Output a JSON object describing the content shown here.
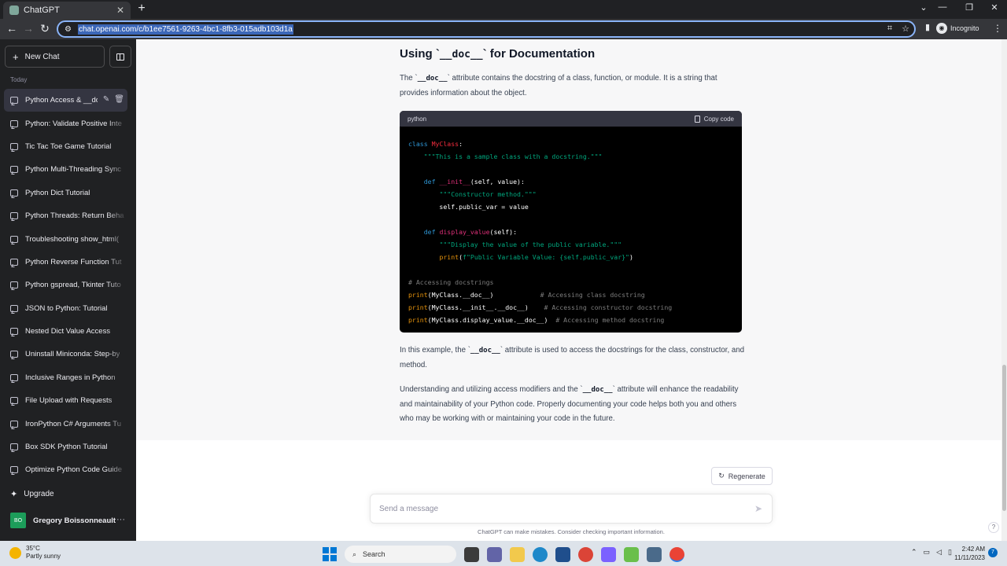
{
  "browser": {
    "tab_title": "ChatGPT",
    "url": "chat.openai.com/c/b1ee7561-9263-4bc1-8fb3-015adb103d1a",
    "incognito_label": "Incognito"
  },
  "sidebar": {
    "new_chat_label": "New Chat",
    "section_label": "Today",
    "items": [
      {
        "label": "Python Access & __do"
      },
      {
        "label": "Python: Validate Positive Inte"
      },
      {
        "label": "Tic Tac Toe Game Tutorial"
      },
      {
        "label": "Python Multi-Threading Sync"
      },
      {
        "label": "Python Dict Tutorial"
      },
      {
        "label": "Python Threads: Return Beha"
      },
      {
        "label": "Troubleshooting show_html("
      },
      {
        "label": "Python Reverse Function Tut"
      },
      {
        "label": "Python gspread, Tkinter Tuto"
      },
      {
        "label": "JSON to Python: Tutorial"
      },
      {
        "label": "Nested Dict Value Access"
      },
      {
        "label": "Uninstall Miniconda: Step-by"
      },
      {
        "label": "Inclusive Ranges in Python"
      },
      {
        "label": "File Upload with Requests"
      },
      {
        "label": "IronPython C# Arguments Tu"
      },
      {
        "label": "Box SDK Python Tutorial"
      },
      {
        "label": "Optimize Python Code Guide"
      }
    ],
    "upgrade_label": "Upgrade",
    "user_initials": "BO",
    "user_name": "Gregory Boissonneault"
  },
  "message": {
    "heading_pre": "Using `",
    "heading_code": "__doc__",
    "heading_post": "` for Documentation",
    "p1_pre": "The `",
    "p1_code": "__doc__",
    "p1_post": "` attribute contains the docstring of a class, function, or module. It is a string that provides information about the object.",
    "code_lang": "python",
    "copy_label": "Copy code",
    "p2_pre": "In this example, the `",
    "p2_code": "__doc__",
    "p2_post": "` attribute is used to access the docstrings for the class, constructor, and method.",
    "p3_pre": "Understanding and utilizing access modifiers and the `",
    "p3_code": "__doc__",
    "p3_post": "` attribute will enhance the readability and maintainability of your Python code. Properly documenting your code helps both you and others who may be working with or maintaining your code in the future."
  },
  "code_lines": [
    [
      {
        "t": "class ",
        "c": "kw"
      },
      {
        "t": "MyClass",
        "c": "cls"
      },
      {
        "t": ":",
        "c": ""
      }
    ],
    [
      {
        "t": "    ",
        "c": ""
      },
      {
        "t": "\"\"\"This is a sample class with a docstring.\"\"\"",
        "c": "str"
      }
    ],
    [
      {
        "t": "",
        "c": ""
      }
    ],
    [
      {
        "t": "    ",
        "c": ""
      },
      {
        "t": "def ",
        "c": "kw"
      },
      {
        "t": "__init__",
        "c": "fn"
      },
      {
        "t": "(self, value):",
        "c": ""
      }
    ],
    [
      {
        "t": "        ",
        "c": ""
      },
      {
        "t": "\"\"\"Constructor method.\"\"\"",
        "c": "str"
      }
    ],
    [
      {
        "t": "        self.public_var = value",
        "c": ""
      }
    ],
    [
      {
        "t": "",
        "c": ""
      }
    ],
    [
      {
        "t": "    ",
        "c": ""
      },
      {
        "t": "def ",
        "c": "kw"
      },
      {
        "t": "display_value",
        "c": "fn"
      },
      {
        "t": "(self):",
        "c": ""
      }
    ],
    [
      {
        "t": "        ",
        "c": ""
      },
      {
        "t": "\"\"\"Display the value of the public variable.\"\"\"",
        "c": "str"
      }
    ],
    [
      {
        "t": "        ",
        "c": ""
      },
      {
        "t": "print",
        "c": "bi"
      },
      {
        "t": "(",
        "c": ""
      },
      {
        "t": "f\"Public Variable Value: {self.public_var}\"",
        "c": "str"
      },
      {
        "t": ")",
        "c": ""
      }
    ],
    [
      {
        "t": "",
        "c": ""
      }
    ],
    [
      {
        "t": "# Accessing docstrings",
        "c": "cmt"
      }
    ],
    [
      {
        "t": "print",
        "c": "bi"
      },
      {
        "t": "(MyClass.__doc__)            ",
        "c": ""
      },
      {
        "t": "# Accessing class docstring",
        "c": "cmt"
      }
    ],
    [
      {
        "t": "print",
        "c": "bi"
      },
      {
        "t": "(MyClass.__init__.__doc__)    ",
        "c": ""
      },
      {
        "t": "# Accessing constructor docstring",
        "c": "cmt"
      }
    ],
    [
      {
        "t": "print",
        "c": "bi"
      },
      {
        "t": "(MyClass.display_value.__doc__)  ",
        "c": ""
      },
      {
        "t": "# Accessing method docstring",
        "c": "cmt"
      }
    ]
  ],
  "composer": {
    "regenerate_label": "Regenerate",
    "placeholder": "Send a message",
    "disclaimer": "ChatGPT can make mistakes. Consider checking important information.",
    "help": "?"
  },
  "taskbar": {
    "temp": "35°C",
    "condition": "Partly sunny",
    "search_label": "Search",
    "time": "2:42 AM",
    "date": "11/11/2023"
  },
  "colors": {
    "sidebar_bg": "#202123",
    "accent": "#8ab4f8",
    "code_bg": "#000000",
    "avatar_bg": "#1c9d5a"
  },
  "icons": [
    "plus-icon",
    "sidebar-toggle-icon",
    "chat-bubble-icon",
    "edit-icon",
    "trash-icon",
    "sparkle-icon",
    "ellipsis-icon",
    "clipboard-icon",
    "refresh-icon",
    "send-icon"
  ]
}
